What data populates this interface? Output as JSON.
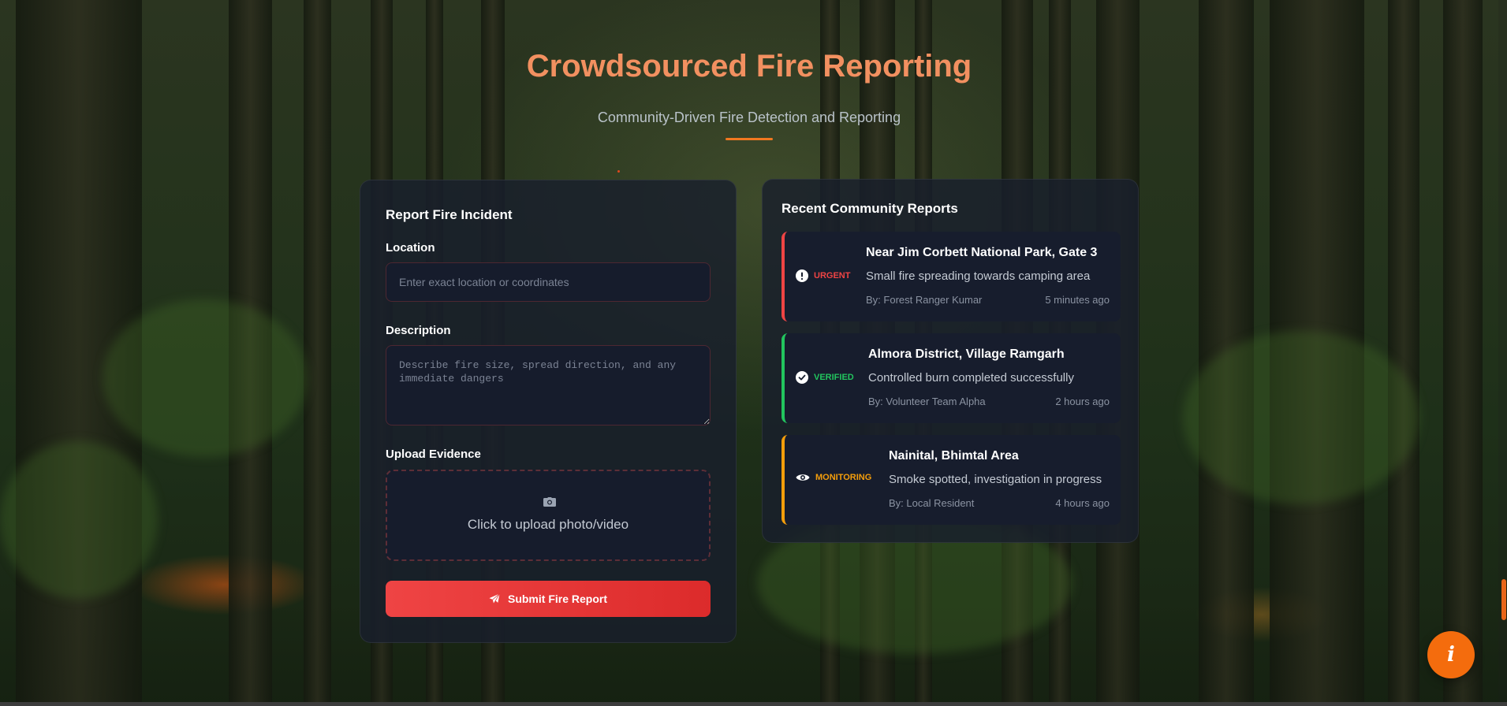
{
  "header": {
    "title": "Crowdsourced Fire Reporting",
    "subtitle": "Community-Driven Fire Detection and Reporting"
  },
  "form": {
    "title": "Report Fire Incident",
    "location_label": "Location",
    "location_placeholder": "Enter exact location or coordinates",
    "location_value": "",
    "description_label": "Description",
    "description_placeholder": "Describe fire size, spread direction, and any immediate dangers",
    "description_value": "",
    "upload_label": "Upload Evidence",
    "upload_icon": "camera-icon",
    "upload_text": "Click to upload photo/video",
    "submit_icon": "paper-plane-icon",
    "submit_label": "Submit Fire Report"
  },
  "reports": {
    "title": "Recent Community Reports",
    "items": [
      {
        "status": "URGENT",
        "status_icon": "exclamation-circle-icon",
        "color": "#ef4444",
        "location": "Near Jim Corbett National Park, Gate 3",
        "description": "Small fire spreading towards camping area",
        "by": "By: Forest Ranger Kumar",
        "time": "5 minutes ago"
      },
      {
        "status": "VERIFIED",
        "status_icon": "check-circle-icon",
        "color": "#22c55e",
        "location": "Almora District, Village Ramgarh",
        "description": "Controlled burn completed successfully",
        "by": "By: Volunteer Team Alpha",
        "time": "2 hours ago"
      },
      {
        "status": "MONITORING",
        "status_icon": "eye-icon",
        "color": "#f59e0b",
        "location": "Nainital, Bhimtal Area",
        "description": "Smoke spotted, investigation in progress",
        "by": "By: Local Resident",
        "time": "4 hours ago"
      }
    ]
  },
  "info_button": {
    "icon": "info-icon",
    "glyph": "i"
  },
  "colors": {
    "title": "#f29060",
    "accent": "#f07820",
    "submit": "#ef4444",
    "info_button": "#f46c0d"
  }
}
